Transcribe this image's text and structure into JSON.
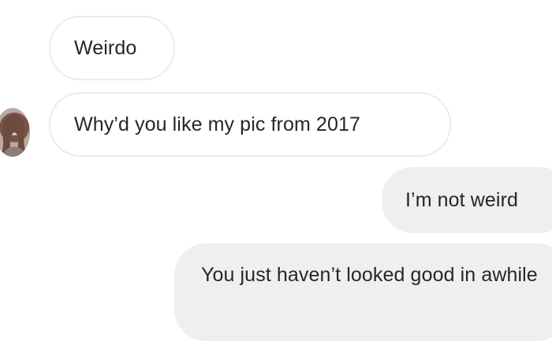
{
  "messages": [
    {
      "sender": "them",
      "text": "Weirdo"
    },
    {
      "sender": "them",
      "text": "Why’d you like my pic from 2017"
    },
    {
      "sender": "me",
      "text": "I’m not weird"
    },
    {
      "sender": "me",
      "text": "You just haven’t looked good in awhile"
    }
  ],
  "avatar": {
    "icon": "profile-photo"
  },
  "colors": {
    "incoming_bubble": "#ffffff",
    "incoming_border": "#ebebeb",
    "outgoing_bubble": "#efefef",
    "text": "#262626"
  }
}
